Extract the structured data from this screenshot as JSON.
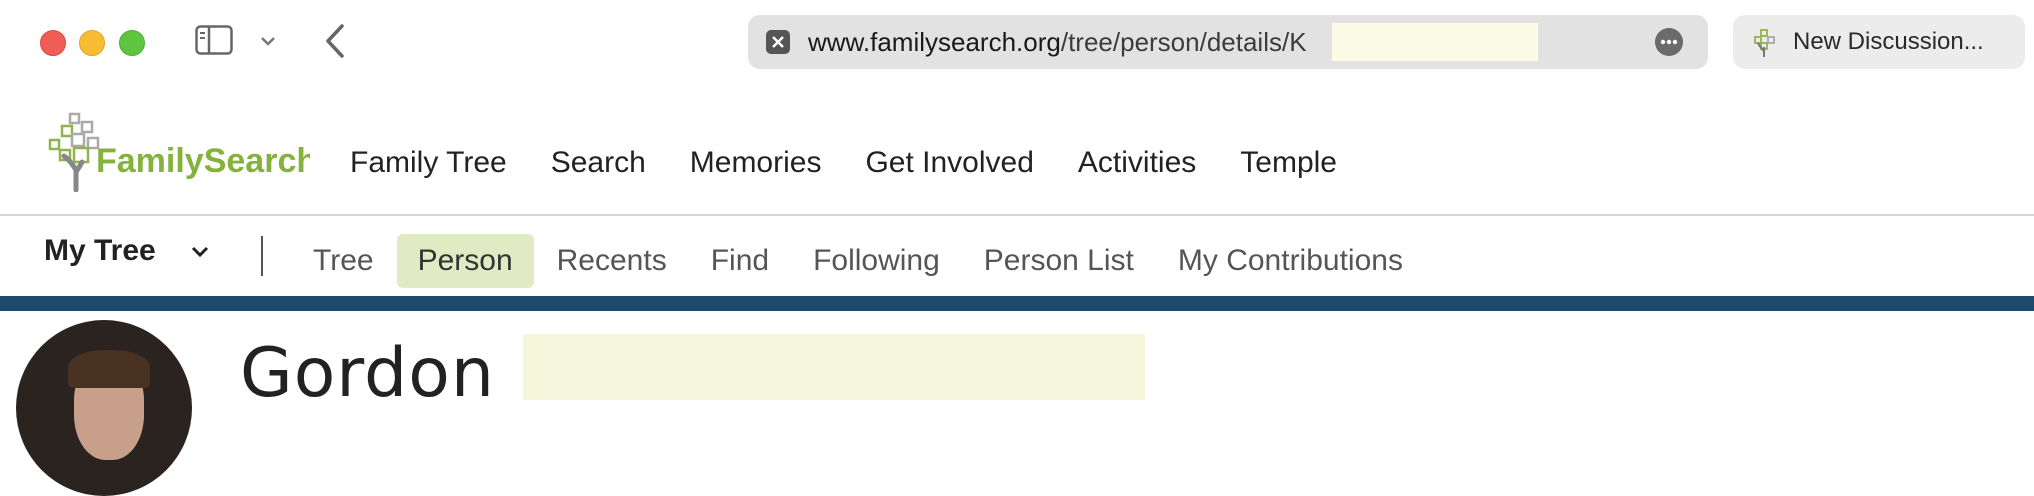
{
  "browser": {
    "url_domain": "www.familysearch.org",
    "url_path": "/tree/person/details/K",
    "extension_label": "New Discussion..."
  },
  "site": {
    "logo_text": "FamilySearch",
    "main_nav": [
      "Family Tree",
      "Search",
      "Memories",
      "Get Involved",
      "Activities",
      "Temple"
    ]
  },
  "subnav": {
    "section_label": "My Tree",
    "items": [
      "Tree",
      "Person",
      "Recents",
      "Find",
      "Following",
      "Person List",
      "My Contributions"
    ],
    "active_item": "Person"
  },
  "person": {
    "given_name": "Gordon"
  },
  "colors": {
    "brand_green": "#85b23c",
    "band_blue": "#1b4a6e",
    "active_tab_bg": "#e0ebc4"
  }
}
